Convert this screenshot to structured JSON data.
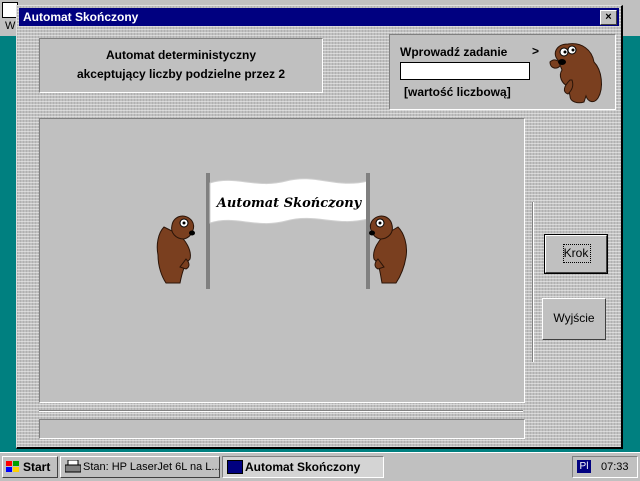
{
  "background": {
    "partial_letter": "W"
  },
  "window": {
    "title": "Automat Skończony",
    "close_glyph": "×"
  },
  "description": {
    "line1": "Automat deterministyczny",
    "line2": "akceptujący liczby podzielne przez 2"
  },
  "input_panel": {
    "label": "Wprowadź zadanie",
    "arrow": ">",
    "value": "",
    "hint": "[wartość liczbową]"
  },
  "banner": {
    "text": "Automat Skończony"
  },
  "buttons": {
    "step_label": "Krok",
    "exit_label": "Wyjście"
  },
  "taskbar": {
    "start_label": "Start",
    "tasks": [
      {
        "label": "Stan: HP LaserJet 6L na L..."
      },
      {
        "label": "Automat Skończony"
      }
    ],
    "language": "Pl",
    "clock": "07:33"
  },
  "colors": {
    "desktop": "#008080",
    "face": "#c0c0c0",
    "titlebar": "#000080",
    "bear": "#7a3f1f"
  }
}
